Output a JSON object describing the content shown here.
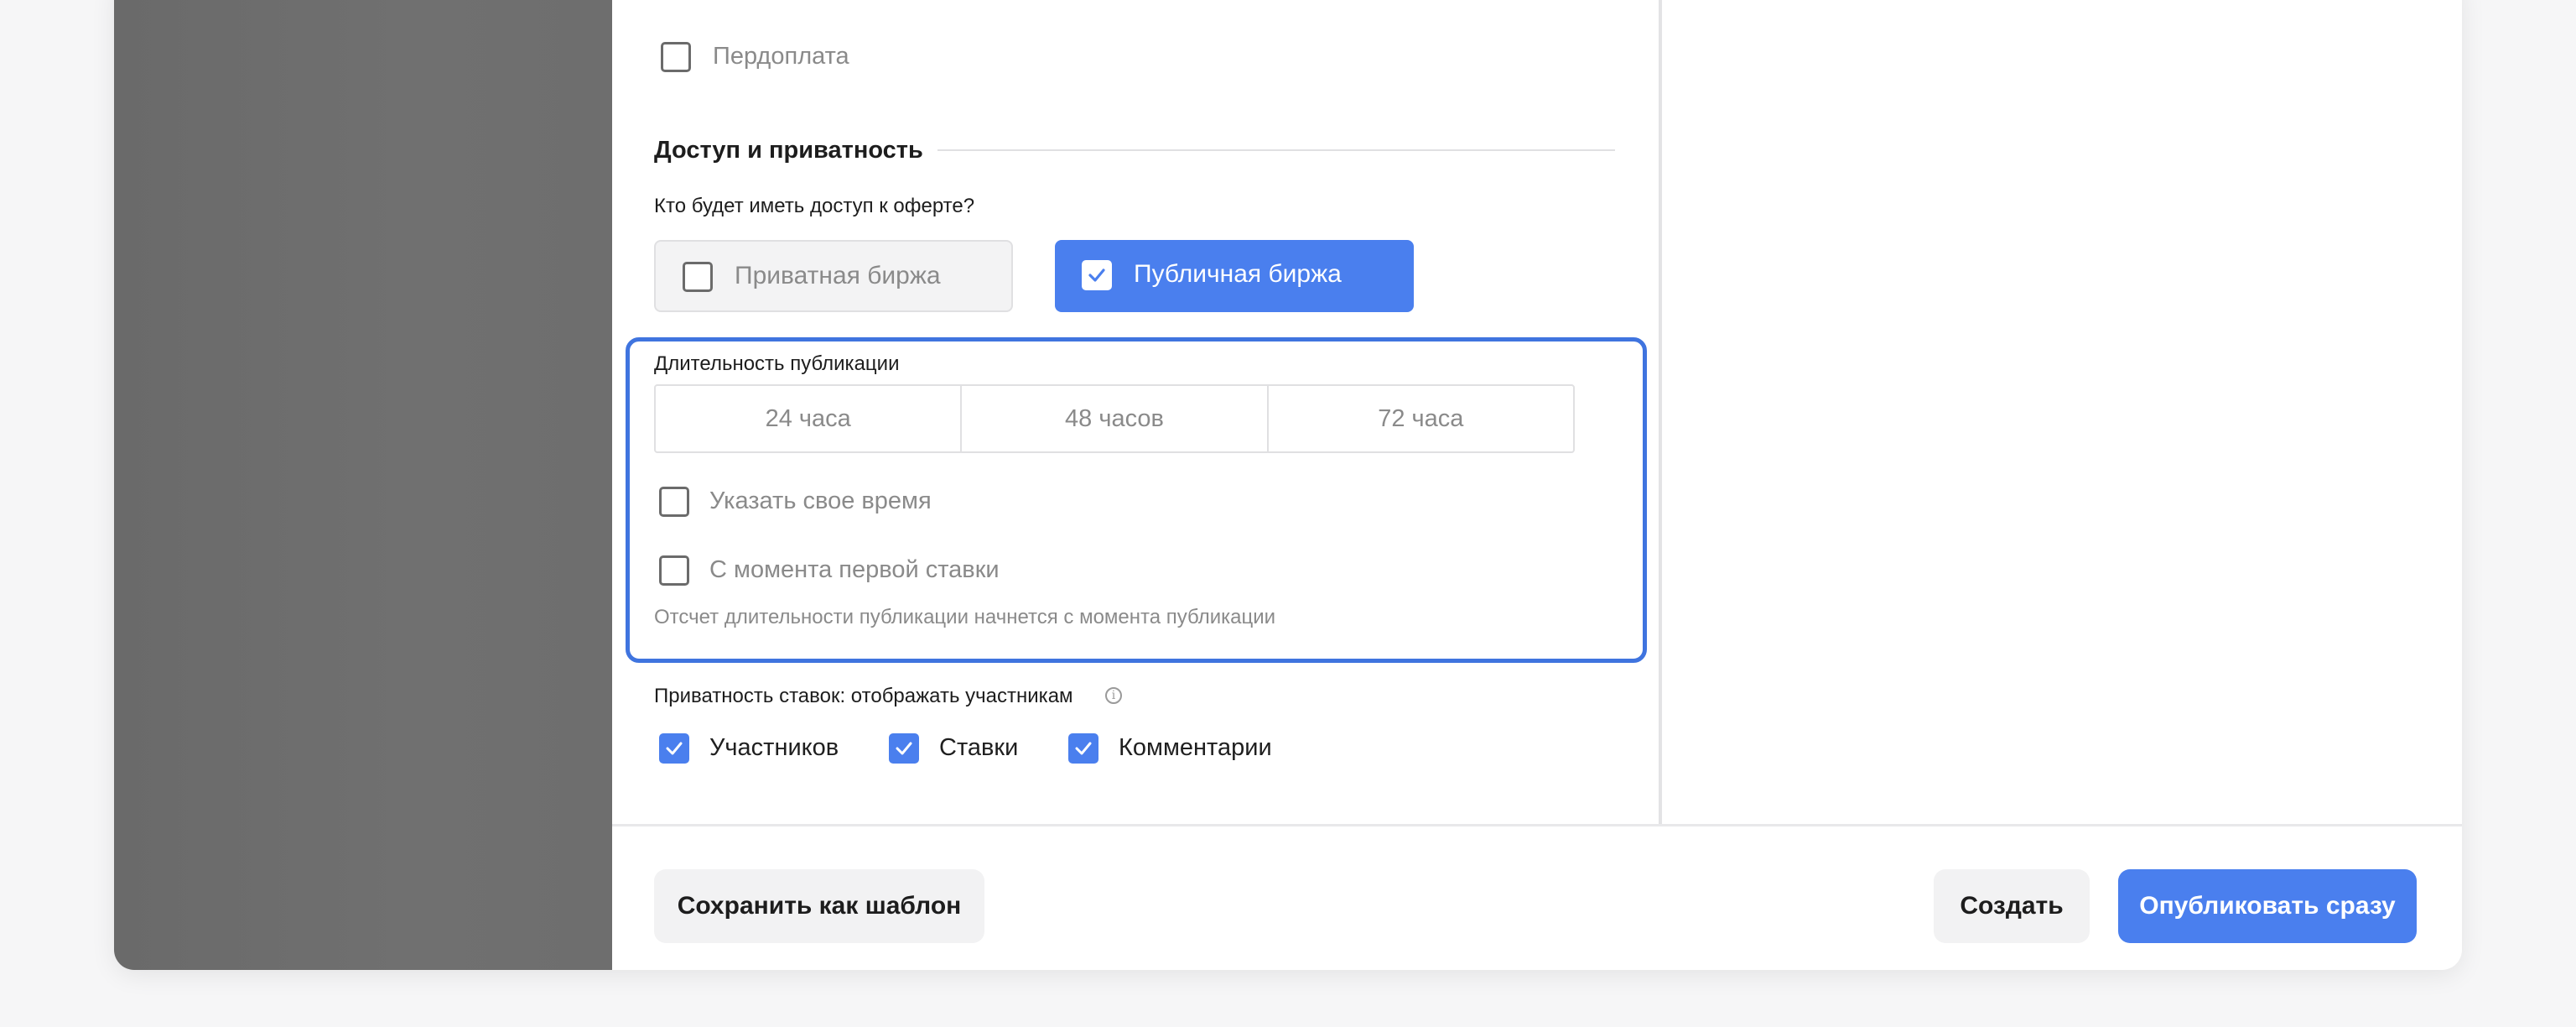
{
  "payment": {
    "prepay_label": "Пердоплата",
    "prepay_checked": false
  },
  "access": {
    "section_title": "Доступ и приватность",
    "question": "Кто будет иметь доступ к оферте?",
    "private_exchange_label": "Приватная биржа",
    "private_exchange_selected": false,
    "public_exchange_label": "Публичная биржа",
    "public_exchange_selected": true
  },
  "duration": {
    "label": "Длительность публикации",
    "options": [
      "24 часа",
      "48 часов",
      "72 часа"
    ],
    "custom_time_label": "Указать свое время",
    "custom_time_checked": false,
    "from_first_bid_label": "С момента первой ставки",
    "from_first_bid_checked": false,
    "hint": "Отсчет длительности публикации начнется с момента публикации"
  },
  "bid_privacy": {
    "label": "Приватность ставок: отображать участникам",
    "info_icon": "info-circle-icon",
    "participants_label": "Участников",
    "participants_checked": true,
    "bids_label": "Ставки",
    "bids_checked": true,
    "comments_label": "Комментарии",
    "comments_checked": true
  },
  "footer": {
    "save_template_label": "Сохранить как шаблон",
    "create_label": "Создать",
    "publish_label": "Опубликовать сразу"
  },
  "colors": {
    "accent": "#4a7fee",
    "highlight_border": "#3f74df"
  }
}
